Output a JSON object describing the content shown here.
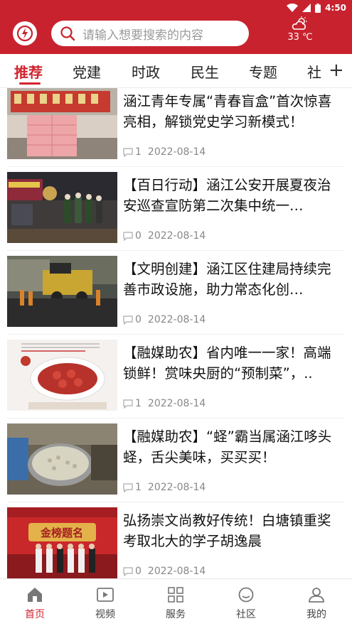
{
  "status_bar": {
    "time": "4:50"
  },
  "header": {
    "search_placeholder": "请输入想要搜索的内容",
    "weather_temp": "33 ℃"
  },
  "tabs": [
    {
      "label": "推荐",
      "active": true
    },
    {
      "label": "党建"
    },
    {
      "label": "时政"
    },
    {
      "label": "民生"
    },
    {
      "label": "专题"
    },
    {
      "label": "社"
    }
  ],
  "add_tab_label": "+",
  "news": [
    {
      "title": "涵江青年专属“青春盲盒”首次惊喜亮相，解锁党史学习新模式！",
      "comments": "1",
      "date": "2022-08-14"
    },
    {
      "title": "【百日行动】涵江公安开展夏夜治安巡查宣防第二次集中统一…",
      "comments": "0",
      "date": "2022-08-14"
    },
    {
      "title": "【文明创建】涵江区住建局持续完善市政设施，助力常态化创…",
      "comments": "0",
      "date": "2022-08-14"
    },
    {
      "title": "【融媒助农】省内唯一一家！高端锁鲜！赏味央厨的“预制菜”，..",
      "comments": "1",
      "date": "2022-08-14"
    },
    {
      "title": "【融媒助农】“蛏”霸当属涵江哆头蛏，舌尖美味，买买买！",
      "comments": "1",
      "date": "2022-08-14"
    },
    {
      "title": "弘扬崇文尚教好传统！白塘镇重奖考取北大的学子胡逸晨",
      "comments": "0",
      "date": "2022-08-14"
    }
  ],
  "thumb_banner_text": "金榜题名",
  "bottom_nav": [
    {
      "label": "首页",
      "icon": "home-icon",
      "active": true
    },
    {
      "label": "视频",
      "icon": "video-icon"
    },
    {
      "label": "服务",
      "icon": "grid-icon"
    },
    {
      "label": "社区",
      "icon": "chat-icon"
    },
    {
      "label": "我的",
      "icon": "user-icon"
    }
  ],
  "colors": {
    "brand": "#c8222e",
    "accent": "#d0242f"
  }
}
